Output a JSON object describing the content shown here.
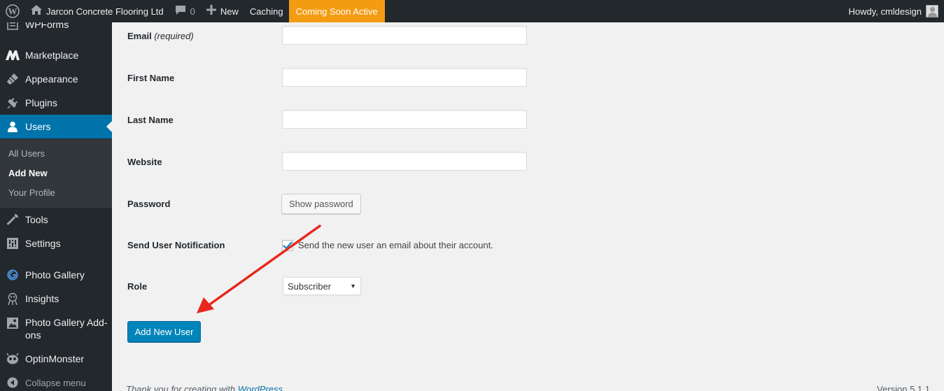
{
  "admin_bar": {
    "site_name": "Jarcon Concrete Flooring Ltd",
    "comments_count": "0",
    "new_label": "New",
    "caching_label": "Caching",
    "coming_soon_label": "Coming Soon Active",
    "howdy_label": "Howdy, cmldesign",
    "coming_soon_color": "#f39c12"
  },
  "sidebar": {
    "items": [
      {
        "label": "WPForms",
        "icon": "wpforms-icon"
      },
      {
        "label": "Marketplace",
        "icon": "marketplace-icon"
      },
      {
        "label": "Appearance",
        "icon": "appearance-icon"
      },
      {
        "label": "Plugins",
        "icon": "plugins-icon"
      },
      {
        "label": "Users",
        "icon": "users-icon"
      },
      {
        "label": "Tools",
        "icon": "tools-icon"
      },
      {
        "label": "Settings",
        "icon": "settings-icon"
      },
      {
        "label": "Photo Gallery",
        "icon": "photo-gallery-icon"
      },
      {
        "label": "Insights",
        "icon": "insights-icon"
      },
      {
        "label": "Photo Gallery Add-ons",
        "icon": "photo-gallery-addons-icon"
      },
      {
        "label": "OptinMonster",
        "icon": "optinmonster-icon"
      }
    ],
    "submenu": [
      "All Users",
      "Add New",
      "Your Profile"
    ],
    "collapse_label": "Collapse menu",
    "active_color": "#0073aa"
  },
  "form": {
    "email_label": "Email",
    "required_label": "(required)",
    "first_name_label": "First Name",
    "last_name_label": "Last Name",
    "website_label": "Website",
    "password_label": "Password",
    "show_password_label": "Show password",
    "notification_label": "Send User Notification",
    "notification_text": "Send the new user an email about their account.",
    "notification_checked": true,
    "role_label": "Role",
    "role_value": "Subscriber",
    "submit_label": "Add New User",
    "email_value": "",
    "first_name_value": "",
    "last_name_value": "",
    "website_value": ""
  },
  "footer": {
    "thanks_text": "Thank you for creating with ",
    "wordpress_link": "WordPress",
    "version": "Version 5.1.1"
  },
  "annotation": {
    "arrow_color": "#e8261d"
  }
}
